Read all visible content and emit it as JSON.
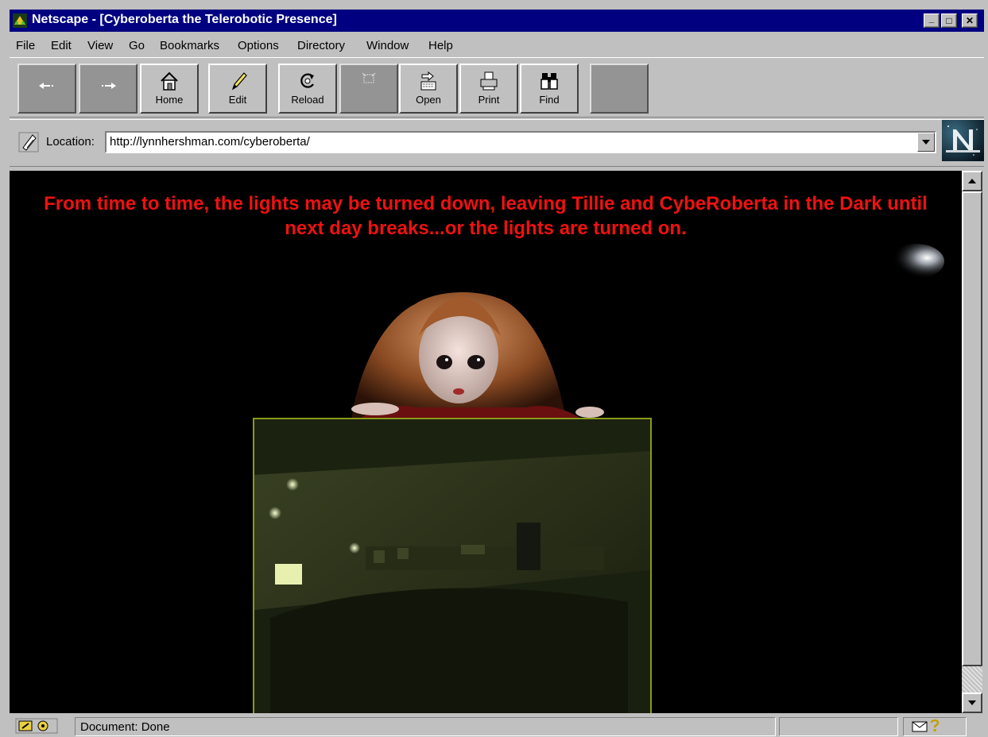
{
  "window": {
    "title": "Netscape - [Cyberoberta the Telerobotic Presence]",
    "controls": {
      "minimize": "_",
      "maximize": "□",
      "close": "✕"
    }
  },
  "menu": {
    "items": [
      {
        "label": "File",
        "icon": ""
      },
      {
        "label": "Edit"
      },
      {
        "label": "View"
      },
      {
        "label": "Go"
      },
      {
        "label": "Bookmarks"
      },
      {
        "label": "Options"
      },
      {
        "label": "Directory"
      },
      {
        "label": "Window"
      },
      {
        "label": "Help"
      }
    ]
  },
  "toolbar": {
    "home_label": "Home",
    "edit_label": "Edit",
    "reload_label": "Reload",
    "open_label": "Open",
    "print_label": "Print",
    "find_label": "Find"
  },
  "location": {
    "label": "Location:",
    "url": "http://lynnhershman.com/cyberoberta/"
  },
  "content": {
    "notice": "From time to time, the lights may be turned down, leaving Tillie and CybeRoberta in the Dark until next day breaks...or the lights are turned on."
  },
  "status": {
    "text": "Document: Done"
  },
  "colors": {
    "titlebar": "#000080",
    "chrome": "#c0c0c0",
    "notice_text": "#ee1111",
    "camera_frame": "#8a9a1a"
  },
  "icons": [
    "netscape-app-icon",
    "back-arrow-icon",
    "forward-arrow-icon",
    "home-icon",
    "edit-pencil-icon",
    "reload-icon",
    "images-icon",
    "open-icon",
    "print-icon",
    "find-binoculars-icon",
    "bookmark-icon",
    "netscape-n-logo",
    "security-key-icon",
    "mail-icon",
    "help-question-icon"
  ]
}
